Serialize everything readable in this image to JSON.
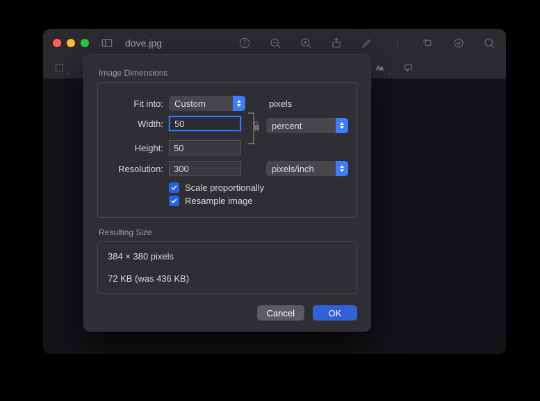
{
  "window": {
    "title": "dove.jpg"
  },
  "dialog": {
    "sections": {
      "dimensions_label": "Image Dimensions",
      "result_label": "Resulting Size"
    },
    "fields": {
      "fit_into_label": "Fit into:",
      "fit_into_value": "Custom",
      "fit_into_unit": "pixels",
      "width_label": "Width:",
      "width_value": "50",
      "height_label": "Height:",
      "height_value": "50",
      "dim_unit_value": "percent",
      "resolution_label": "Resolution:",
      "resolution_value": "300",
      "resolution_unit_value": "pixels/inch",
      "scale_label": "Scale proportionally",
      "resample_label": "Resample image",
      "scale_checked": true,
      "resample_checked": true
    },
    "result": {
      "size_text": "384 × 380 pixels",
      "filesize_text": "72 KB (was 436 KB)"
    },
    "buttons": {
      "cancel": "Cancel",
      "ok": "OK"
    }
  }
}
